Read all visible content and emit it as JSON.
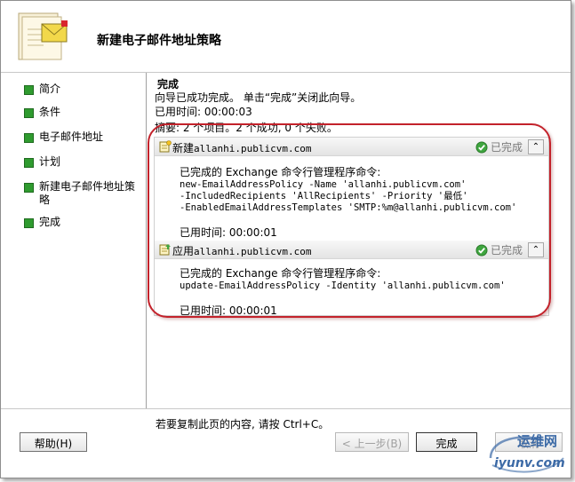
{
  "wizard": {
    "title": "新建电子邮件地址策略"
  },
  "sidebar": {
    "items": [
      {
        "label": "简介"
      },
      {
        "label": "条件"
      },
      {
        "label": "电子邮件地址"
      },
      {
        "label": "计划"
      },
      {
        "label": "新建电子邮件地址策略"
      },
      {
        "label": "完成"
      }
    ]
  },
  "content": {
    "section_title": "完成",
    "status_text": "向导已成功完成。 单击“完成”关闭此向导。",
    "elapsed_total": "已用时间: 00:00:03",
    "summary": "摘要: 2 个项目。2 个成功, 0 个失败。",
    "tasks": [
      {
        "prefix": "新建",
        "target": "allanhi.publicvm.com",
        "status": "已完成",
        "body_heading": "已完成的 Exchange 命令行管理程序命令:",
        "command_lines": [
          "new-EmailAddressPolicy -Name 'allanhi.publicvm.com'",
          "-IncludedRecipients 'AllRecipients' -Priority '最低'",
          "-EnabledEmailAddressTemplates 'SMTP:%m@allanhi.publicvm.com'"
        ],
        "elapsed": "已用时间: 00:00:01"
      },
      {
        "prefix": "应用",
        "target": "allanhi.publicvm.com",
        "status": "已完成",
        "body_heading": "已完成的 Exchange 命令行管理程序命令:",
        "command_lines": [
          "update-EmailAddressPolicy -Identity 'allanhi.publicvm.com'"
        ],
        "elapsed": "已用时间: 00:00:01"
      }
    ],
    "copy_hint": "若要复制此页的内容, 请按 Ctrl+C。"
  },
  "buttons": {
    "help": "帮助(H)",
    "back": "< 上一步(B)",
    "finish": "完成",
    "cancel": "取消"
  },
  "watermark": {
    "site_name": "运维网",
    "url": "iyunv.com"
  },
  "colors": {
    "nav_bullet": "#2f9b2f",
    "highlight_oval": "#c3222b",
    "watermark": "#3c6aa6"
  }
}
